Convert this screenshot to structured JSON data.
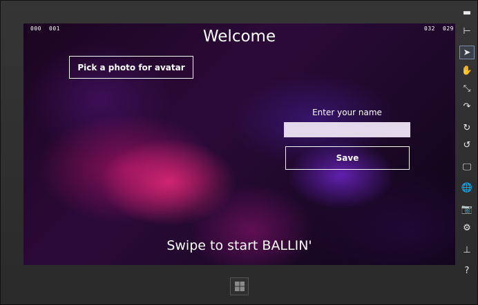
{
  "screen": {
    "counters": {
      "top_left_1": "000",
      "top_left_2": "001",
      "top_right_1": "032",
      "top_right_2": "029"
    },
    "title": "Welcome",
    "avatar_button_label": "Pick a photo for avatar",
    "name_label": "Enter your name",
    "name_input_value": "",
    "save_button_label": "Save",
    "swipe_text": "Swipe to start BALLIN'"
  },
  "sidebar": {
    "items": [
      {
        "icon": "minimize-icon",
        "glyph": "▬"
      },
      {
        "icon": "pin-icon",
        "glyph": "⊢"
      },
      {
        "icon": "pointer-icon",
        "glyph": "➤"
      },
      {
        "icon": "hand-icon",
        "glyph": "✋"
      },
      {
        "icon": "pinch-icon",
        "glyph": "⤡"
      },
      {
        "icon": "rotate-gesture-icon",
        "glyph": "↷"
      },
      {
        "icon": "rotate-clockwise-icon",
        "glyph": "↻"
      },
      {
        "icon": "rotate-counterclockwise-icon",
        "glyph": "↺"
      },
      {
        "icon": "resolution-icon",
        "glyph": "🖵"
      },
      {
        "icon": "location-icon",
        "glyph": "🌐"
      },
      {
        "icon": "camera-icon",
        "glyph": "📷"
      },
      {
        "icon": "settings-icon",
        "glyph": "⚙"
      },
      {
        "icon": "network-icon",
        "glyph": "⊥"
      },
      {
        "icon": "help-icon",
        "glyph": "?"
      }
    ]
  },
  "colors": {
    "bezel": "#2b2b2b",
    "input_bg": "#e3d9ea",
    "accent": "#7f8ca8"
  }
}
